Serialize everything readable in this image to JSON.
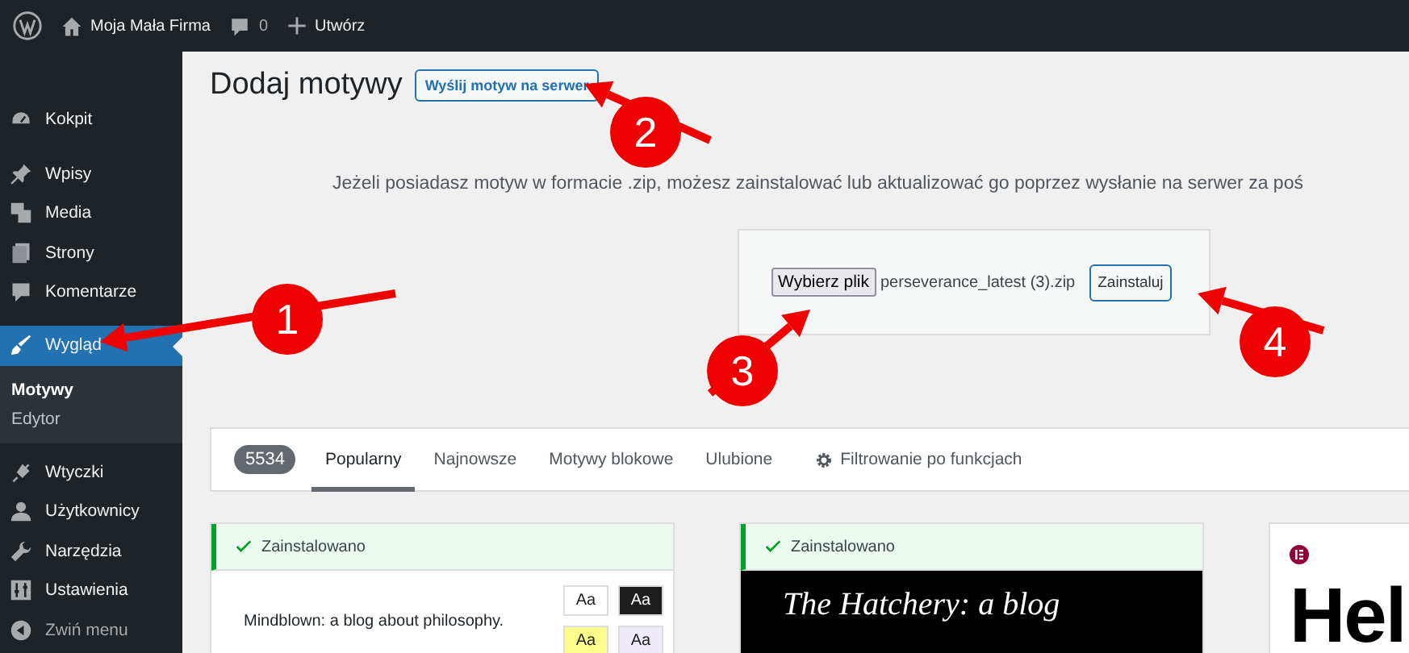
{
  "admin_bar": {
    "site_name": "Moja Mała Firma",
    "comments_count": "0",
    "new_label": "Utwórz"
  },
  "sidebar": {
    "items": [
      {
        "label": "Kokpit",
        "selected": false
      },
      {
        "label": "Wpisy",
        "selected": false
      },
      {
        "label": "Media",
        "selected": false
      },
      {
        "label": "Strony",
        "selected": false
      },
      {
        "label": "Komentarze",
        "selected": false
      },
      {
        "label": "Wygląd",
        "selected": true,
        "children": [
          {
            "label": "Motywy",
            "selected": true
          },
          {
            "label": "Edytor",
            "selected": false
          }
        ]
      },
      {
        "label": "Wtyczki",
        "selected": false
      },
      {
        "label": "Użytkownicy",
        "selected": false
      },
      {
        "label": "Narzędzia",
        "selected": false
      },
      {
        "label": "Ustawienia",
        "selected": false
      },
      {
        "label": "Zwiń menu",
        "selected": false
      }
    ]
  },
  "page": {
    "title": "Dodaj motywy",
    "upload_button": "Wyślij motyw na serwer",
    "description": "Jeżeli posiadasz motyw w formacie .zip, możesz zainstalować lub aktualizować go poprzez wysłanie na serwer za poś",
    "upload_form": {
      "choose_button": "Wybierz plik",
      "file_name": "perseverance_latest (3).zip",
      "install_button": "Zainstaluj"
    }
  },
  "filter_bar": {
    "count": "5534",
    "tabs": [
      {
        "label": "Popularny",
        "selected": true
      },
      {
        "label": "Najnowsze",
        "selected": false
      },
      {
        "label": "Motywy blokowe",
        "selected": false
      },
      {
        "label": "Ulubione",
        "selected": false
      }
    ],
    "feature_filter": "Filtrowanie po funkcjach"
  },
  "themes": [
    {
      "kind": "styles",
      "installed": true,
      "status": "Zainstalowano",
      "preview_text": "Mindblown: a blog about philosophy.",
      "swatches": [
        {
          "label": "Aa",
          "color": "#ffffff"
        },
        {
          "label": "Aa",
          "color": "#1e1e1e"
        },
        {
          "label": "Aa",
          "color": "#fdfb8c"
        },
        {
          "label": "Aa",
          "color": "#eeeaf8"
        }
      ]
    },
    {
      "kind": "dark",
      "installed": true,
      "status": "Zainstalowano",
      "preview_text": "The Hatchery: a blog"
    },
    {
      "kind": "logo",
      "installed": false,
      "preview_text": "Hel"
    }
  ],
  "annotations": [
    {
      "label": "1"
    },
    {
      "label": "2"
    },
    {
      "label": "3"
    },
    {
      "label": "4"
    }
  ]
}
